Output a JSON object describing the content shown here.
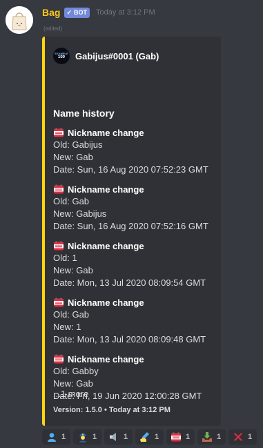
{
  "message": {
    "username": "Bag",
    "bot_tag": "BOT",
    "timestamp": "Today at 3:12 PM",
    "edited": "(edited)",
    "username_color": "#fcc719"
  },
  "embed": {
    "accent_color": "#fcd50f",
    "author_icon_text_top": "EXAMPLE",
    "author_icon_text_bottom": "100",
    "author": "Gabijus#0001 (Gab)",
    "title": "Name history",
    "fields": [
      {
        "name": "Nickname change",
        "old": "Old: Gabijus",
        "new": "New: Gab",
        "date": "Date: Sun, 16 Aug 2020 07:52:23 GMT"
      },
      {
        "name": "Nickname change",
        "old": "Old: Gab",
        "new": "New: Gabijus",
        "date": "Date: Sun, 16 Aug 2020 07:52:16 GMT"
      },
      {
        "name": "Nickname change",
        "old": "Old: 1",
        "new": "New: Gab",
        "date": "Date: Mon, 13 Jul 2020 08:09:54 GMT"
      },
      {
        "name": "Nickname change",
        "old": "Old: Gab",
        "new": "New: 1",
        "date": "Date: Mon, 13 Jul 2020 08:09:48 GMT"
      },
      {
        "name": "Nickname change",
        "old": "Old: Gabby",
        "new": "New: Gab",
        "date": "Date: Fri, 19 Jun 2020 12:00:28 GMT"
      }
    ],
    "more": "...1 more",
    "footer": "Version: 1.5.0 • Today at 3:12 PM"
  },
  "reactions": [
    {
      "icon": "bust-icon",
      "count": "1"
    },
    {
      "icon": "police-officer-icon",
      "count": "1"
    },
    {
      "icon": "speaker-icon",
      "count": "1"
    },
    {
      "icon": "writing-hand-icon",
      "count": "1"
    },
    {
      "icon": "calendar-icon",
      "count": "1"
    },
    {
      "icon": "inbox-tray-icon",
      "count": "1"
    },
    {
      "icon": "cross-mark-icon",
      "count": "1"
    }
  ]
}
